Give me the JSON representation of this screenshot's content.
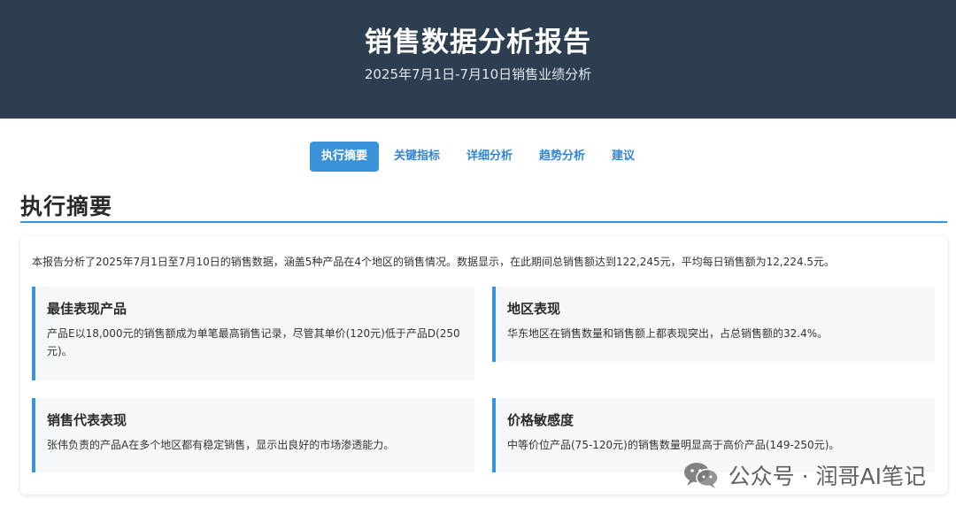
{
  "header": {
    "title": "销售数据分析报告",
    "subtitle": "2025年7月1日-7月10日销售业绩分析"
  },
  "nav": {
    "items": [
      {
        "label": "执行摘要",
        "active": true
      },
      {
        "label": "关键指标",
        "active": false
      },
      {
        "label": "详细分析",
        "active": false
      },
      {
        "label": "趋势分析",
        "active": false
      },
      {
        "label": "建议",
        "active": false
      }
    ]
  },
  "section": {
    "title": "执行摘要",
    "intro": "本报告分析了2025年7月1日至7月10日的销售数据，涵盖5种产品在4个地区的销售情况。数据显示，在此期间总销售额达到122,245元，平均每日销售额为12,224.5元。"
  },
  "highlights": [
    {
      "title": "最佳表现产品",
      "text": "产品E以18,000元的销售额成为单笔最高销售记录，尽管其单价(120元)低于产品D(250元)。"
    },
    {
      "title": "地区表现",
      "text": "华东地区在销售数量和销售额上都表现突出，占总销售额的32.4%。"
    },
    {
      "title": "销售代表表现",
      "text": "张伟负责的产品A在多个地区都有稳定销售，显示出良好的市场渗透能力。"
    },
    {
      "title": "价格敏感度",
      "text": "中等价位产品(75-120元)的销售数量明显高于高价产品(149-250元)。"
    }
  ],
  "watermark": {
    "text": "公众号 · 润哥AI笔记",
    "icon": "wechat-icon"
  },
  "colors": {
    "header_bg": "#2c3e50",
    "accent": "#3a93d9"
  }
}
